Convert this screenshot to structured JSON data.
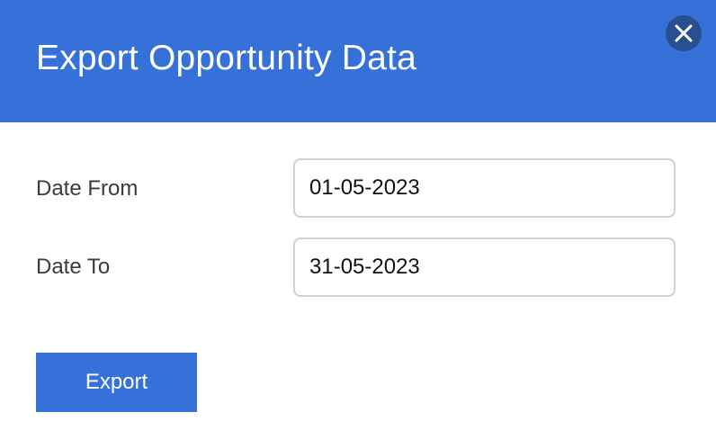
{
  "dialog": {
    "title": "Export Opportunity Data",
    "close_icon": "close-icon"
  },
  "form": {
    "date_from": {
      "label": "Date From",
      "value": "01-05-2023"
    },
    "date_to": {
      "label": "Date To",
      "value": "31-05-2023"
    },
    "export_label": "Export"
  },
  "colors": {
    "header_background": "#3571d8",
    "close_button_background": "#2a4f91",
    "button_background": "#3571d8",
    "input_border": "#d0d0d0"
  }
}
